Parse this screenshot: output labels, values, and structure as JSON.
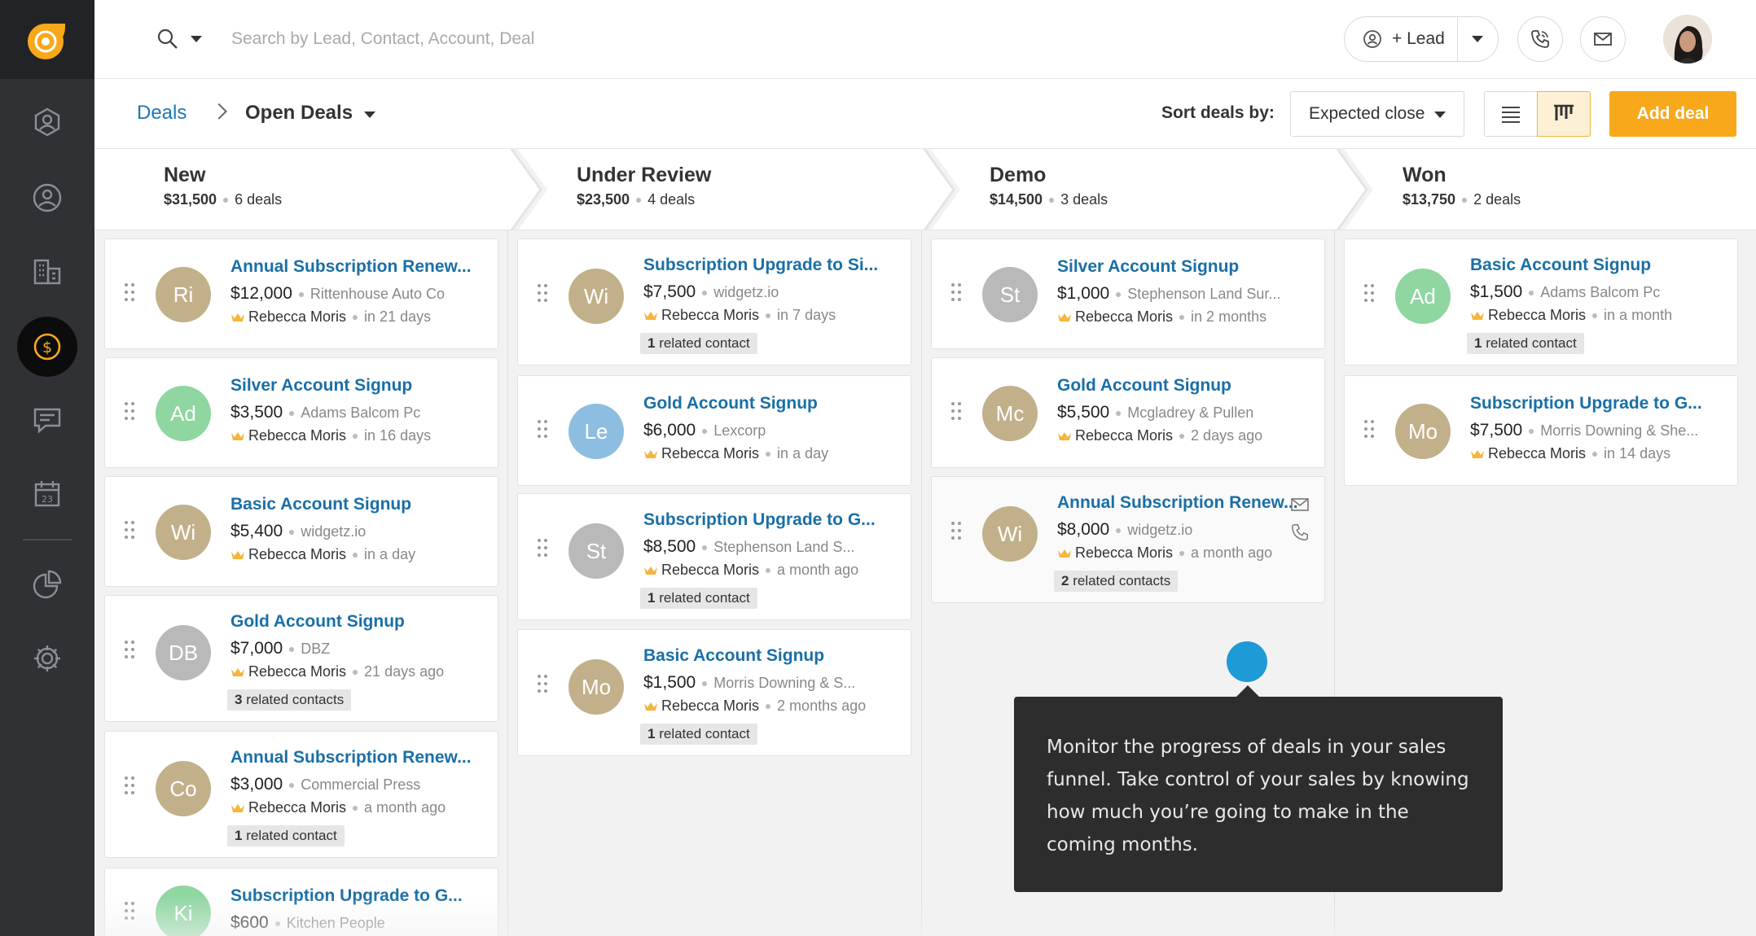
{
  "search": {
    "placeholder": "Search by Lead, Contact, Account, Deal"
  },
  "topbar": {
    "lead_label": "+ Lead"
  },
  "breadcrumb": {
    "root": "Deals",
    "current": "Open Deals"
  },
  "sort": {
    "label": "Sort deals by:",
    "value": "Expected close"
  },
  "add_deal_label": "Add deal",
  "colors": {
    "accent": "#f8a91b",
    "link": "#1a6fa6",
    "sidebar": "#2f3134",
    "hotspot": "#1e9ad6"
  },
  "stages": [
    {
      "name": "New",
      "amount": "$31,500",
      "count": "6 deals"
    },
    {
      "name": "Under Review",
      "amount": "$23,500",
      "count": "4 deals"
    },
    {
      "name": "Demo",
      "amount": "$14,500",
      "count": "3 deals"
    },
    {
      "name": "Won",
      "amount": "$13,750",
      "count": "2 deals"
    }
  ],
  "columns": [
    {
      "cards": [
        {
          "initials": "Ri",
          "color": "#c2b08a",
          "title": "Annual Subscription Renew...",
          "amount": "$12,000",
          "company": "Rittenhouse Auto Co",
          "owner": "Rebecca Moris",
          "when": "in 21 days",
          "related": ""
        },
        {
          "initials": "Ad",
          "color": "#8fd6a0",
          "title": "Silver Account Signup",
          "amount": "$3,500",
          "company": "Adams Balcom Pc",
          "owner": "Rebecca Moris",
          "when": "in 16 days",
          "related": ""
        },
        {
          "initials": "Wi",
          "color": "#c2b08a",
          "title": "Basic Account Signup",
          "amount": "$5,400",
          "company": "widgetz.io",
          "owner": "Rebecca Moris",
          "when": "in a day",
          "related": ""
        },
        {
          "initials": "DB",
          "color": "#b9b9b9",
          "title": "Gold Account Signup",
          "amount": "$7,000",
          "company": "DBZ",
          "owner": "Rebecca Moris",
          "when": "21 days ago",
          "related": "3 related contacts",
          "related_n": "3",
          "related_t": "related contacts"
        },
        {
          "initials": "Co",
          "color": "#c2b08a",
          "title": "Annual Subscription Renew...",
          "amount": "$3,000",
          "company": "Commercial Press",
          "owner": "Rebecca Moris",
          "when": "a month ago",
          "related": "1 related contact",
          "related_n": "1",
          "related_t": "related contact"
        },
        {
          "initials": "Ki",
          "color": "#8fd6a0",
          "title": "Subscription Upgrade to G...",
          "amount": "$600",
          "company": "Kitchen People",
          "owner": "",
          "when": "",
          "related": ""
        }
      ]
    },
    {
      "cards": [
        {
          "initials": "Wi",
          "color": "#c2b08a",
          "title": "Subscription Upgrade to Si...",
          "amount": "$7,500",
          "company": "widgetz.io",
          "owner": "Rebecca Moris",
          "when": "in 7 days",
          "related_n": "1",
          "related_t": "related contact"
        },
        {
          "initials": "Le",
          "color": "#8dbde0",
          "title": "Gold Account Signup",
          "amount": "$6,000",
          "company": "Lexcorp",
          "owner": "Rebecca Moris",
          "when": "in a day"
        },
        {
          "initials": "St",
          "color": "#b9b9b9",
          "title": "Subscription Upgrade to G...",
          "amount": "$8,500",
          "company": "Stephenson Land S...",
          "owner": "Rebecca Moris",
          "when": "a month ago",
          "related_n": "1",
          "related_t": "related contact"
        },
        {
          "initials": "Mo",
          "color": "#c2b08a",
          "title": "Basic Account Signup",
          "amount": "$1,500",
          "company": "Morris Downing & S...",
          "owner": "Rebecca Moris",
          "when": "2 months ago",
          "related_n": "1",
          "related_t": "related contact"
        }
      ]
    },
    {
      "cards": [
        {
          "initials": "St",
          "color": "#b9b9b9",
          "title": "Silver Account Signup",
          "amount": "$1,000",
          "company": "Stephenson Land Sur...",
          "owner": "Rebecca Moris",
          "when": "in 2 months"
        },
        {
          "initials": "Mc",
          "color": "#c2b08a",
          "title": "Gold Account Signup",
          "amount": "$5,500",
          "company": "Mcgladrey & Pullen",
          "owner": "Rebecca Moris",
          "when": "2 days ago"
        },
        {
          "initials": "Wi",
          "color": "#c2b08a",
          "title": "Annual Subscription Renew...",
          "amount": "$8,000",
          "company": "widgetz.io",
          "owner": "Rebecca Moris",
          "when": "a month ago",
          "related_n": "2",
          "related_t": "related contacts"
        }
      ]
    },
    {
      "cards": [
        {
          "initials": "Ad",
          "color": "#8fd6a0",
          "title": "Basic Account Signup",
          "amount": "$1,500",
          "company": "Adams Balcom Pc",
          "owner": "Rebecca Moris",
          "when": "in a month",
          "related_n": "1",
          "related_t": "related contact"
        },
        {
          "initials": "Mo",
          "color": "#c2b08a",
          "title": "Subscription Upgrade to G...",
          "amount": "$7,500",
          "company": "Morris Downing & She...",
          "owner": "Rebecca Moris",
          "when": "in 14 days"
        }
      ]
    }
  ],
  "tooltip": {
    "text": "Monitor the progress of deals in your sales funnel. Take control of your sales by knowing how much you’re going to make in the coming months."
  }
}
